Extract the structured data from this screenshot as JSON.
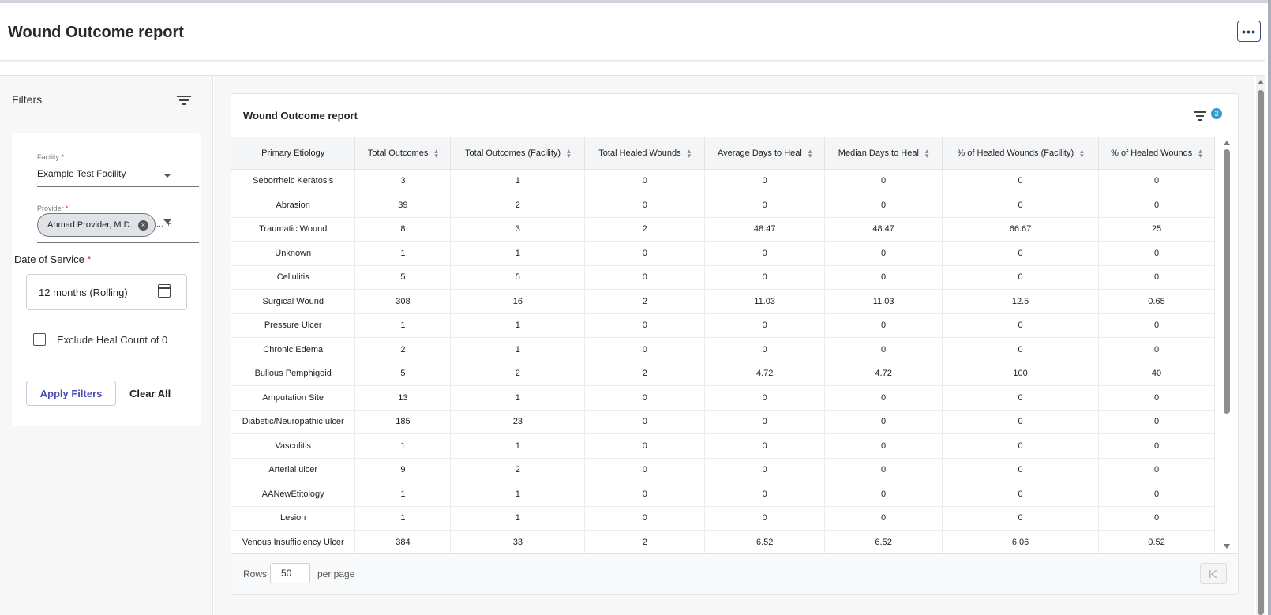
{
  "header": {
    "title": "Wound Outcome report",
    "more_label": "•••"
  },
  "filters": {
    "title": "Filters",
    "facility": {
      "label": "Facility",
      "required_mark": "*",
      "value": "Example Test Facility"
    },
    "provider": {
      "label": "Provider",
      "required_mark": "*",
      "chip": "Ahmad Provider, M.D.",
      "chip_remove": "×",
      "more": "... +"
    },
    "date_of_service": {
      "label": "Date of Service",
      "required_mark": "*",
      "value": "12 months (Rolling)"
    },
    "exclude_heal_count": {
      "label": "Exclude Heal Count of 0",
      "checked": false
    },
    "apply_label": "Apply Filters",
    "clear_label": "Clear All"
  },
  "report": {
    "title": "Wound Outcome report",
    "active_filter_count": "3",
    "columns": [
      "Primary Etiology",
      "Total Outcomes",
      "Total Outcomes (Facility)",
      "Total Healed Wounds",
      "Average Days to Heal",
      "Median Days to Heal",
      "% of Healed Wounds (Facility)",
      "% of Healed Wounds"
    ],
    "rows": [
      [
        "Seborrheic Keratosis",
        "3",
        "1",
        "0",
        "0",
        "0",
        "0",
        "0"
      ],
      [
        "Abrasion",
        "39",
        "2",
        "0",
        "0",
        "0",
        "0",
        "0"
      ],
      [
        "Traumatic Wound",
        "8",
        "3",
        "2",
        "48.47",
        "48.47",
        "66.67",
        "25"
      ],
      [
        "Unknown",
        "1",
        "1",
        "0",
        "0",
        "0",
        "0",
        "0"
      ],
      [
        "Cellulitis",
        "5",
        "5",
        "0",
        "0",
        "0",
        "0",
        "0"
      ],
      [
        "Surgical Wound",
        "308",
        "16",
        "2",
        "11.03",
        "11.03",
        "12.5",
        "0.65"
      ],
      [
        "Pressure Ulcer",
        "1",
        "1",
        "0",
        "0",
        "0",
        "0",
        "0"
      ],
      [
        "Chronic Edema",
        "2",
        "1",
        "0",
        "0",
        "0",
        "0",
        "0"
      ],
      [
        "Bullous Pemphigoid",
        "5",
        "2",
        "2",
        "4.72",
        "4.72",
        "100",
        "40"
      ],
      [
        "Amputation Site",
        "13",
        "1",
        "0",
        "0",
        "0",
        "0",
        "0"
      ],
      [
        "Diabetic/Neuropathic ulcer",
        "185",
        "23",
        "0",
        "0",
        "0",
        "0",
        "0"
      ],
      [
        "Vasculitis",
        "1",
        "1",
        "0",
        "0",
        "0",
        "0",
        "0"
      ],
      [
        "Arterial ulcer",
        "9",
        "2",
        "0",
        "0",
        "0",
        "0",
        "0"
      ],
      [
        "AANewEtitology",
        "1",
        "1",
        "0",
        "0",
        "0",
        "0",
        "0"
      ],
      [
        "Lesion",
        "1",
        "1",
        "0",
        "0",
        "0",
        "0",
        "0"
      ],
      [
        "Venous Insufficiency Ulcer",
        "384",
        "33",
        "2",
        "6.52",
        "6.52",
        "6.06",
        "0.52"
      ]
    ],
    "pagination": {
      "rows_label": "Rows",
      "rows_per_page": "50",
      "per_page_label": "per page"
    }
  },
  "colors": {
    "accent": "#4a4fb0",
    "badge": "#3a9ac9",
    "required": "#d32f2f"
  }
}
